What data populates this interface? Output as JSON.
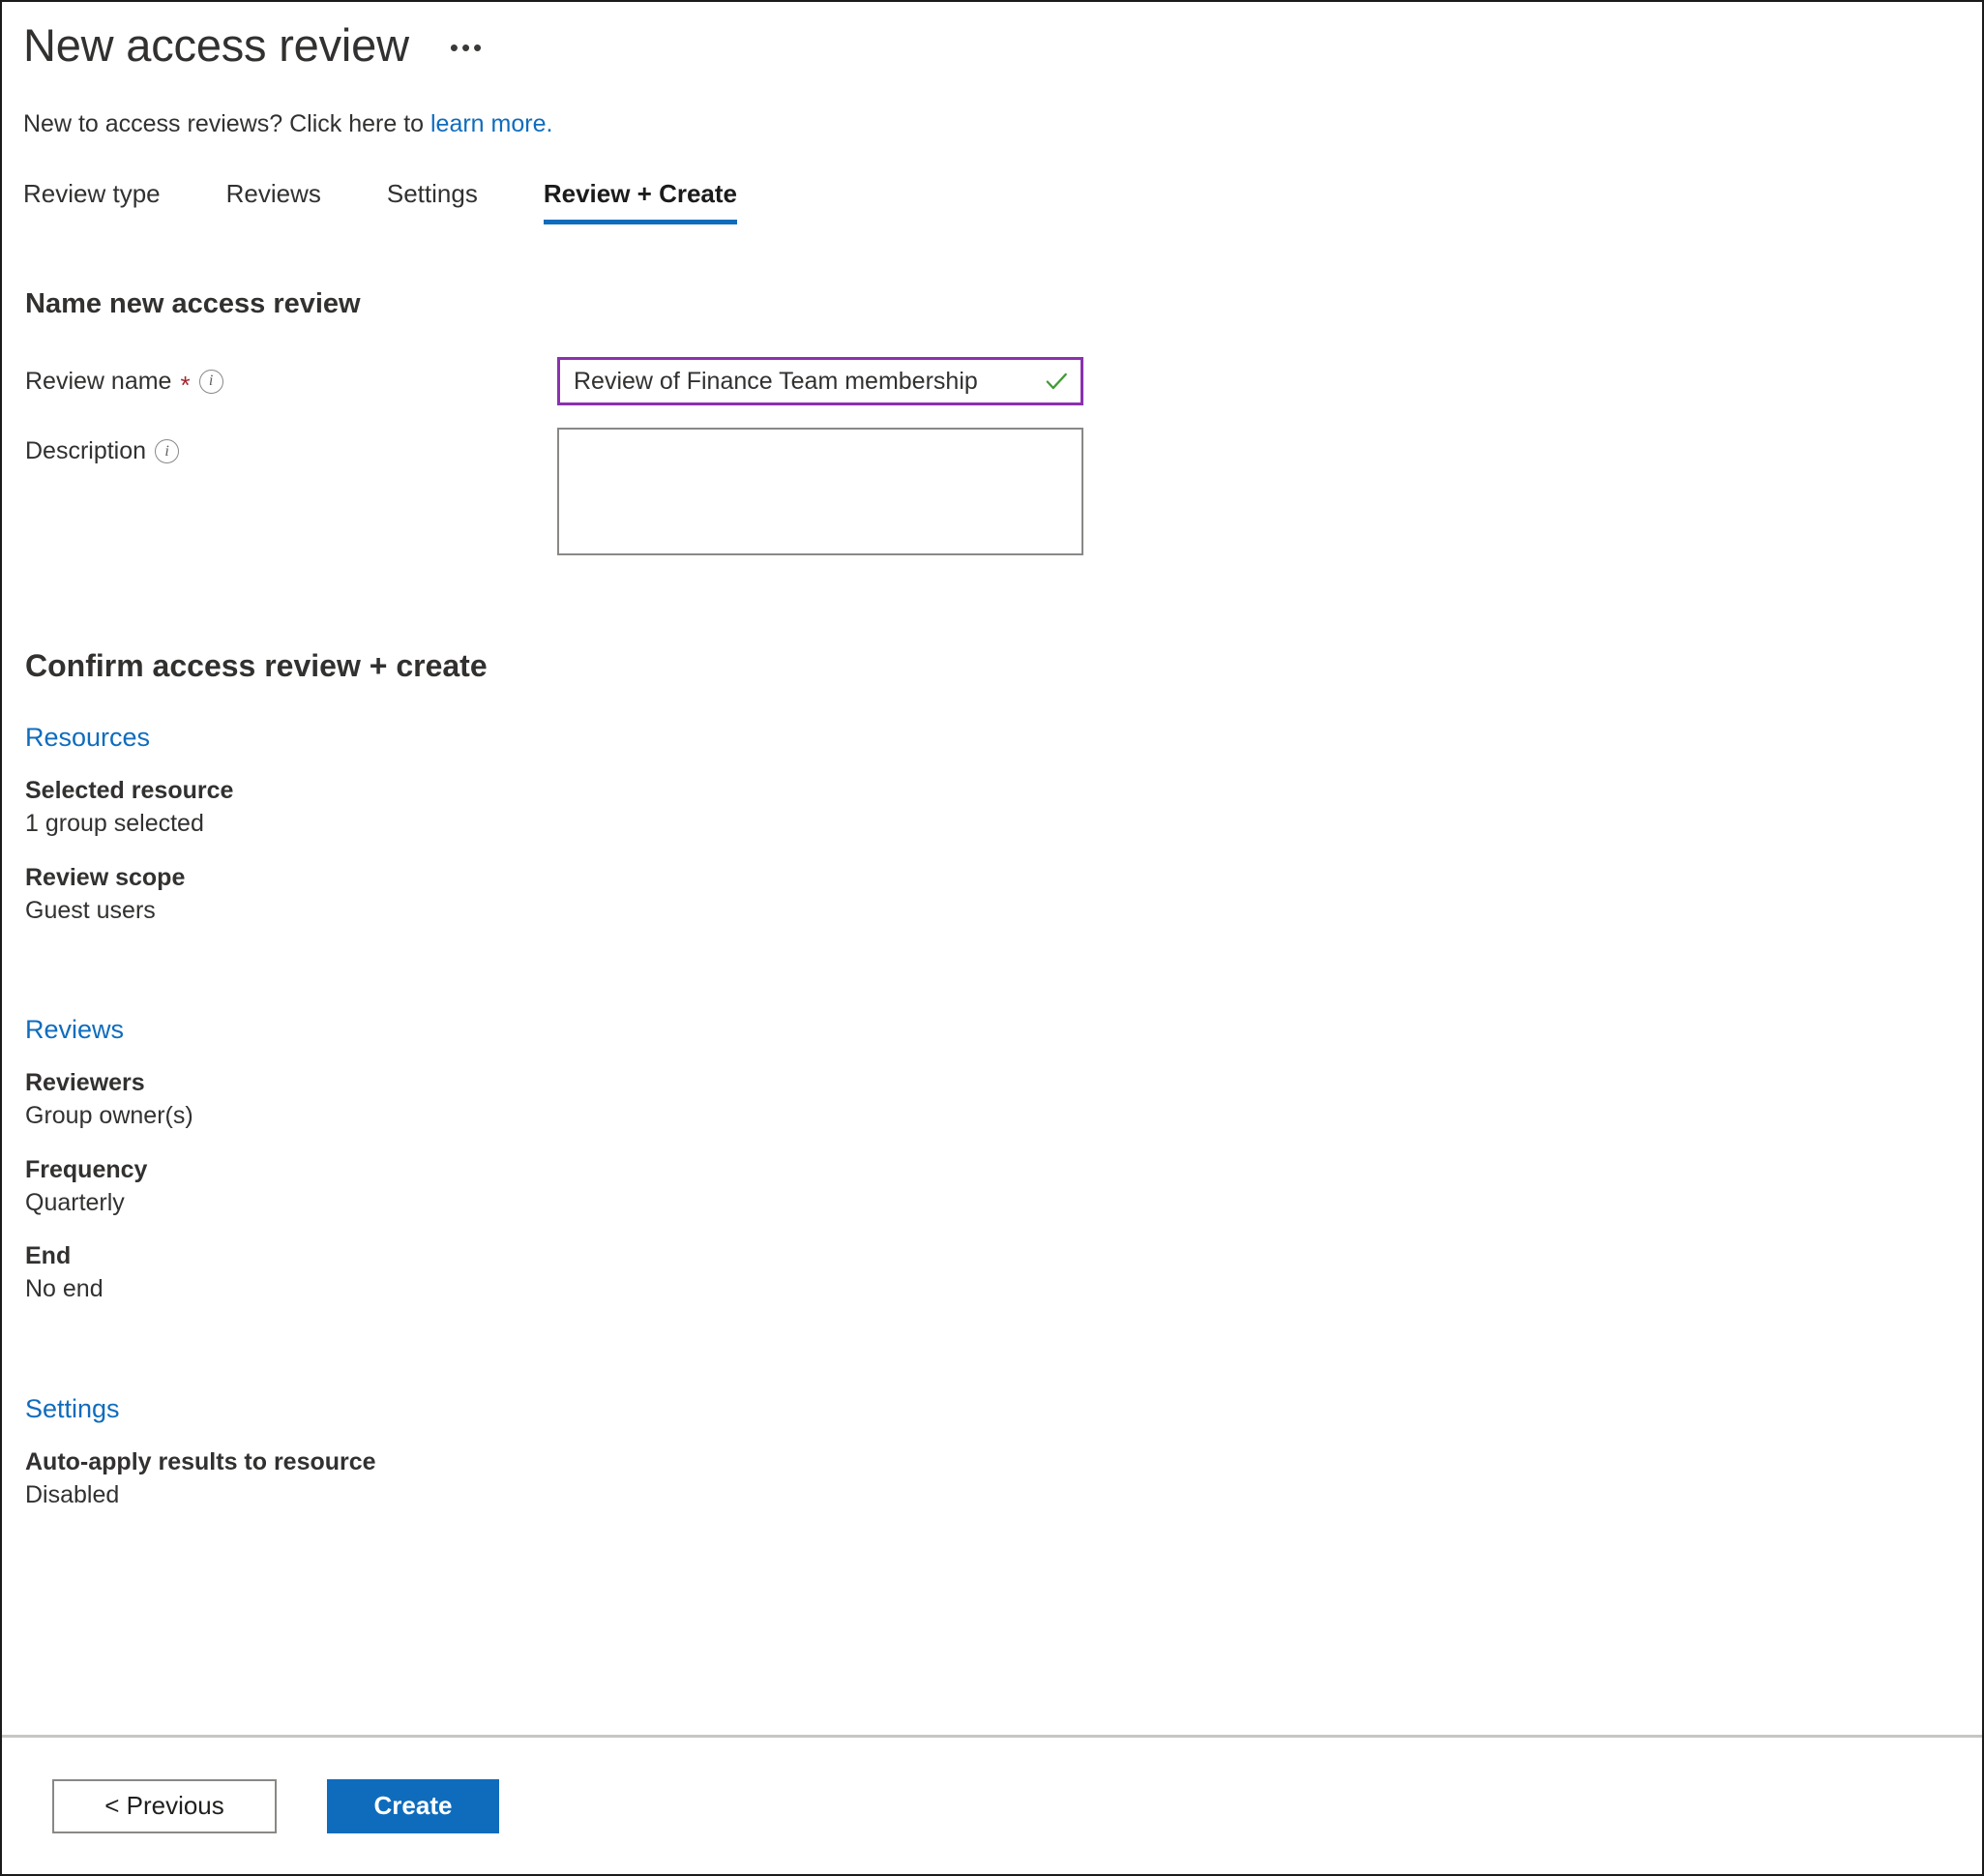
{
  "header": {
    "title": "New access review",
    "overflow_menu": "•••",
    "subtitle_prefix": "New to access reviews? Click here to ",
    "subtitle_link": "learn more."
  },
  "tabs": [
    {
      "label": "Review type",
      "active": false
    },
    {
      "label": "Reviews",
      "active": false
    },
    {
      "label": "Settings",
      "active": false
    },
    {
      "label": "Review + Create",
      "active": true
    }
  ],
  "name_section": {
    "heading": "Name new access review",
    "review_name": {
      "label": "Review name",
      "required_marker": "*",
      "info_glyph": "i",
      "value": "Review of Finance Team membership",
      "placeholder": "",
      "validation_state": "valid"
    },
    "description": {
      "label": "Description",
      "info_glyph": "i",
      "value": "",
      "placeholder": ""
    }
  },
  "confirm_section": {
    "heading": "Confirm access review + create",
    "groups": [
      {
        "link": "Resources",
        "items": [
          {
            "key": "Selected resource",
            "value": "1 group selected"
          },
          {
            "key": "Review scope",
            "value": "Guest users"
          }
        ]
      },
      {
        "link": "Reviews",
        "items": [
          {
            "key": "Reviewers",
            "value": "Group owner(s)"
          },
          {
            "key": "Frequency",
            "value": "Quarterly"
          },
          {
            "key": "End",
            "value": "No end"
          }
        ]
      },
      {
        "link": "Settings",
        "items": [
          {
            "key": "Auto-apply results to resource",
            "value": "Disabled"
          }
        ]
      }
    ]
  },
  "footer": {
    "previous_label": "< Previous",
    "create_label": "Create"
  },
  "colors": {
    "accent_blue": "#0f6cbd",
    "link_blue": "#0f6cbd",
    "input_focus_purple": "#8b31af",
    "valid_green": "#3f9c35",
    "required_red": "#a4262c",
    "text_primary": "#323130",
    "divider_gray": "#c8c6c4"
  }
}
